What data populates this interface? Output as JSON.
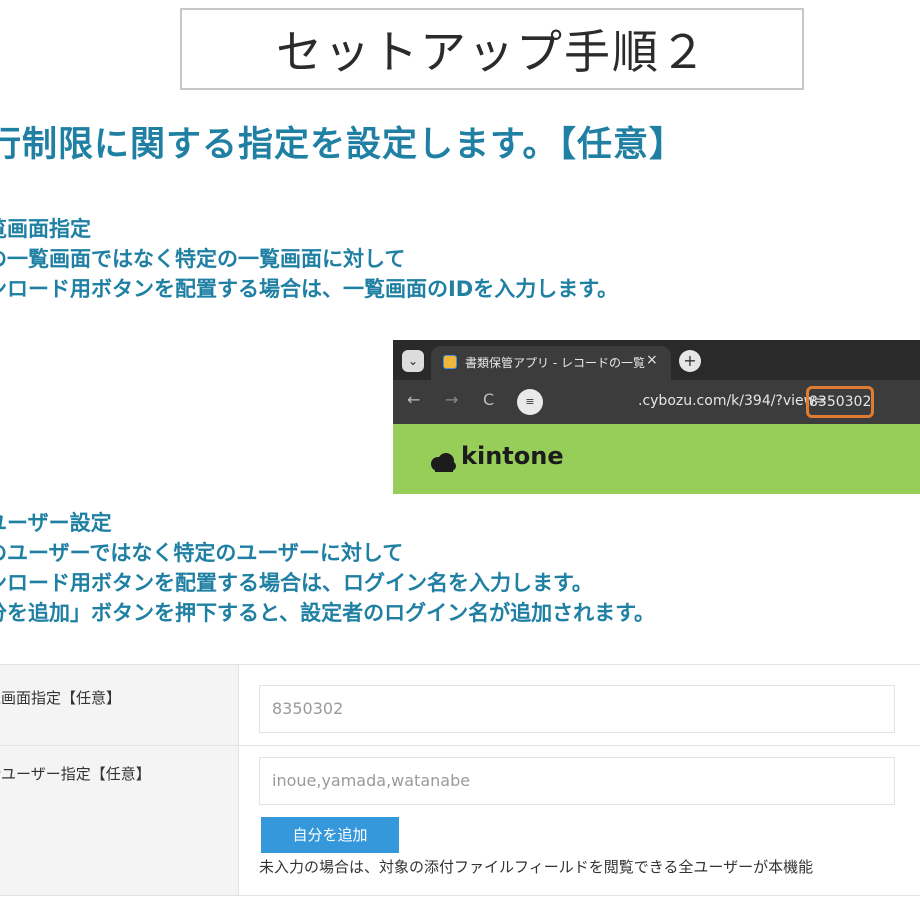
{
  "slide": {
    "title": "セットアップ手順２",
    "heading": "行制限に関する指定を設定します。【任意】",
    "section1": [
      "覧画面指定",
      "の一覧画面ではなく特定の一覧画面に対して",
      "ンロード用ボタンを配置する場合は、一覧画面のIDを入力します。"
    ],
    "section2": [
      "ユーザー設定",
      "のユーザーではなく特定のユーザーに対して",
      "ンロード用ボタンを配置する場合は、ログイン名を入力します。",
      "分を追加」ボタンを押下すると、設定者のログイン名が追加されます。"
    ]
  },
  "browser": {
    "tab_title": "書類保管アプリ - レコードの一覧",
    "tab_close": "×",
    "new_tab": "+",
    "url_prefix": ".cybozu.com/k/394/?view=",
    "url_view_id": "8350302",
    "logo_text": "kintone",
    "menu_glyph": "⌄",
    "back_glyph": "←",
    "forward_glyph": "→",
    "reload_glyph": "C",
    "siteinfo_glyph": "≡",
    "content_color": "#97ce5a",
    "highlight_color": "#e07b32"
  },
  "form": {
    "view_label": "覧画面指定【任意】",
    "view_value": "8350302",
    "user_label": "行ユーザー指定【任意】",
    "user_value": "inoue,yamada,watanabe",
    "add_self_button": "自分を追加",
    "note": "未入力の場合は、対象の添付ファイルフィールドを閲覧できる全ユーザーが本機能"
  },
  "colors": {
    "heading": "#1f80a3",
    "button": "#3498db"
  }
}
